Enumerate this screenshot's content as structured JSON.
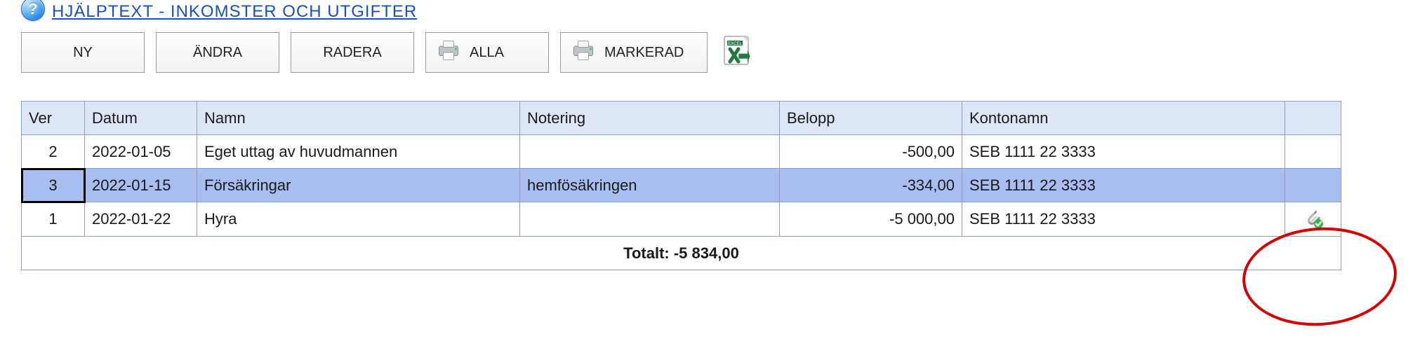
{
  "help_link": {
    "label": "HJÄLPTEXT - INKOMSTER OCH UTGIFTER"
  },
  "toolbar": {
    "ny": "NY",
    "andra": "ÄNDRA",
    "radera": "RADERA",
    "alla": "ALLA",
    "markerad": "MARKERAD"
  },
  "table": {
    "headers": {
      "ver": "Ver",
      "datum": "Datum",
      "namn": "Namn",
      "not": "Notering",
      "belopp": "Belopp",
      "konto": "Kontonamn"
    },
    "rows": [
      {
        "ver": "2",
        "datum": "2022-01-05",
        "namn": "Eget uttag av huvudmannen",
        "not": "",
        "belopp": "-500,00",
        "konto": "SEB 1111 22 3333",
        "selected": false,
        "attachment": false
      },
      {
        "ver": "3",
        "datum": "2022-01-15",
        "namn": "Försäkringar",
        "not": "hemfösäkringen",
        "belopp": "-334,00",
        "konto": "SEB 1111 22 3333",
        "selected": true,
        "attachment": false
      },
      {
        "ver": "1",
        "datum": "2022-01-22",
        "namn": "Hyra",
        "not": "",
        "belopp": "-5 000,00",
        "konto": "SEB 1111 22 3333",
        "selected": false,
        "attachment": true
      }
    ],
    "footer": "Totalt: -5 834,00"
  }
}
